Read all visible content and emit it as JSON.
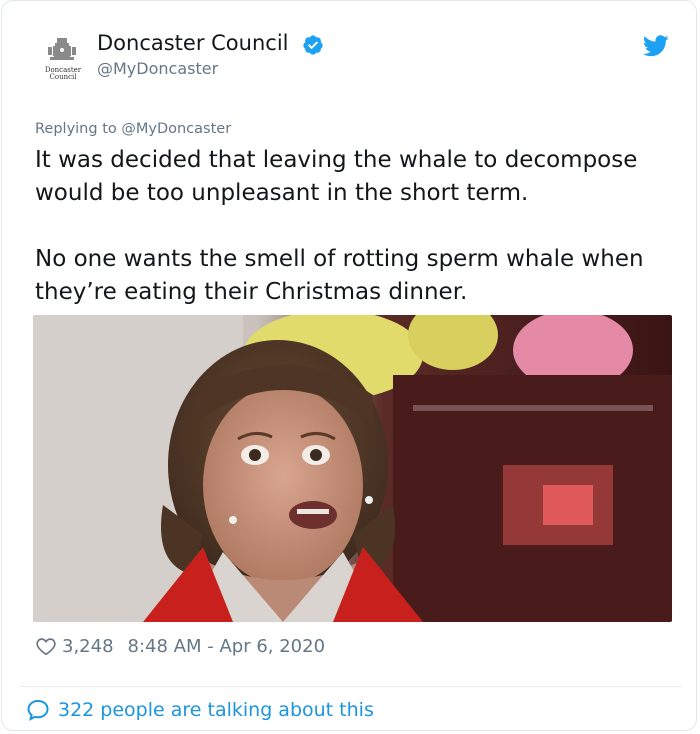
{
  "header": {
    "display_name": "Doncaster Council",
    "handle": "@MyDoncaster",
    "avatar_lines": [
      "Doncaster",
      "Council"
    ]
  },
  "tweet": {
    "replying_prefix": "Replying to ",
    "replying_to": "@MyDoncaster",
    "paragraphs": [
      "It was decided that leaving the whale to decompose would be too unpleasant in the short term.",
      "No one wants the smell of rotting sperm whale when they’re eating their Christmas dinner."
    ]
  },
  "footer": {
    "likes": "3,248",
    "timestamp": "8:48 AM - Apr 6, 2020",
    "talking": "322 people are talking about this"
  },
  "colors": {
    "accent": "#1da1f2",
    "link": "#1b95e0",
    "muted": "#657786",
    "text": "#14171a"
  },
  "icons": [
    "doncaster-crest-icon",
    "verified-badge-icon",
    "twitter-bird-icon",
    "heart-icon",
    "speech-bubble-icon"
  ]
}
